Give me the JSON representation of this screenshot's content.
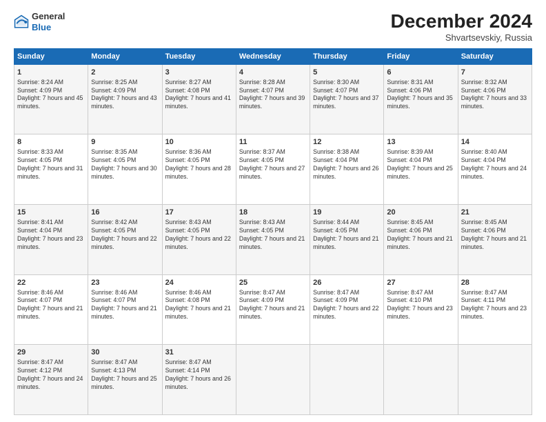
{
  "logo": {
    "general": "General",
    "blue": "Blue"
  },
  "header": {
    "month": "December 2024",
    "location": "Shvartsevskiy, Russia"
  },
  "weekdays": [
    "Sunday",
    "Monday",
    "Tuesday",
    "Wednesday",
    "Thursday",
    "Friday",
    "Saturday"
  ],
  "weeks": [
    [
      {
        "day": "1",
        "sunrise": "Sunrise: 8:24 AM",
        "sunset": "Sunset: 4:09 PM",
        "daylight": "Daylight: 7 hours and 45 minutes."
      },
      {
        "day": "2",
        "sunrise": "Sunrise: 8:25 AM",
        "sunset": "Sunset: 4:09 PM",
        "daylight": "Daylight: 7 hours and 43 minutes."
      },
      {
        "day": "3",
        "sunrise": "Sunrise: 8:27 AM",
        "sunset": "Sunset: 4:08 PM",
        "daylight": "Daylight: 7 hours and 41 minutes."
      },
      {
        "day": "4",
        "sunrise": "Sunrise: 8:28 AM",
        "sunset": "Sunset: 4:07 PM",
        "daylight": "Daylight: 7 hours and 39 minutes."
      },
      {
        "day": "5",
        "sunrise": "Sunrise: 8:30 AM",
        "sunset": "Sunset: 4:07 PM",
        "daylight": "Daylight: 7 hours and 37 minutes."
      },
      {
        "day": "6",
        "sunrise": "Sunrise: 8:31 AM",
        "sunset": "Sunset: 4:06 PM",
        "daylight": "Daylight: 7 hours and 35 minutes."
      },
      {
        "day": "7",
        "sunrise": "Sunrise: 8:32 AM",
        "sunset": "Sunset: 4:06 PM",
        "daylight": "Daylight: 7 hours and 33 minutes."
      }
    ],
    [
      {
        "day": "8",
        "sunrise": "Sunrise: 8:33 AM",
        "sunset": "Sunset: 4:05 PM",
        "daylight": "Daylight: 7 hours and 31 minutes."
      },
      {
        "day": "9",
        "sunrise": "Sunrise: 8:35 AM",
        "sunset": "Sunset: 4:05 PM",
        "daylight": "Daylight: 7 hours and 30 minutes."
      },
      {
        "day": "10",
        "sunrise": "Sunrise: 8:36 AM",
        "sunset": "Sunset: 4:05 PM",
        "daylight": "Daylight: 7 hours and 28 minutes."
      },
      {
        "day": "11",
        "sunrise": "Sunrise: 8:37 AM",
        "sunset": "Sunset: 4:05 PM",
        "daylight": "Daylight: 7 hours and 27 minutes."
      },
      {
        "day": "12",
        "sunrise": "Sunrise: 8:38 AM",
        "sunset": "Sunset: 4:04 PM",
        "daylight": "Daylight: 7 hours and 26 minutes."
      },
      {
        "day": "13",
        "sunrise": "Sunrise: 8:39 AM",
        "sunset": "Sunset: 4:04 PM",
        "daylight": "Daylight: 7 hours and 25 minutes."
      },
      {
        "day": "14",
        "sunrise": "Sunrise: 8:40 AM",
        "sunset": "Sunset: 4:04 PM",
        "daylight": "Daylight: 7 hours and 24 minutes."
      }
    ],
    [
      {
        "day": "15",
        "sunrise": "Sunrise: 8:41 AM",
        "sunset": "Sunset: 4:04 PM",
        "daylight": "Daylight: 7 hours and 23 minutes."
      },
      {
        "day": "16",
        "sunrise": "Sunrise: 8:42 AM",
        "sunset": "Sunset: 4:05 PM",
        "daylight": "Daylight: 7 hours and 22 minutes."
      },
      {
        "day": "17",
        "sunrise": "Sunrise: 8:43 AM",
        "sunset": "Sunset: 4:05 PM",
        "daylight": "Daylight: 7 hours and 22 minutes."
      },
      {
        "day": "18",
        "sunrise": "Sunrise: 8:43 AM",
        "sunset": "Sunset: 4:05 PM",
        "daylight": "Daylight: 7 hours and 21 minutes."
      },
      {
        "day": "19",
        "sunrise": "Sunrise: 8:44 AM",
        "sunset": "Sunset: 4:05 PM",
        "daylight": "Daylight: 7 hours and 21 minutes."
      },
      {
        "day": "20",
        "sunrise": "Sunrise: 8:45 AM",
        "sunset": "Sunset: 4:06 PM",
        "daylight": "Daylight: 7 hours and 21 minutes."
      },
      {
        "day": "21",
        "sunrise": "Sunrise: 8:45 AM",
        "sunset": "Sunset: 4:06 PM",
        "daylight": "Daylight: 7 hours and 21 minutes."
      }
    ],
    [
      {
        "day": "22",
        "sunrise": "Sunrise: 8:46 AM",
        "sunset": "Sunset: 4:07 PM",
        "daylight": "Daylight: 7 hours and 21 minutes."
      },
      {
        "day": "23",
        "sunrise": "Sunrise: 8:46 AM",
        "sunset": "Sunset: 4:07 PM",
        "daylight": "Daylight: 7 hours and 21 minutes."
      },
      {
        "day": "24",
        "sunrise": "Sunrise: 8:46 AM",
        "sunset": "Sunset: 4:08 PM",
        "daylight": "Daylight: 7 hours and 21 minutes."
      },
      {
        "day": "25",
        "sunrise": "Sunrise: 8:47 AM",
        "sunset": "Sunset: 4:09 PM",
        "daylight": "Daylight: 7 hours and 21 minutes."
      },
      {
        "day": "26",
        "sunrise": "Sunrise: 8:47 AM",
        "sunset": "Sunset: 4:09 PM",
        "daylight": "Daylight: 7 hours and 22 minutes."
      },
      {
        "day": "27",
        "sunrise": "Sunrise: 8:47 AM",
        "sunset": "Sunset: 4:10 PM",
        "daylight": "Daylight: 7 hours and 23 minutes."
      },
      {
        "day": "28",
        "sunrise": "Sunrise: 8:47 AM",
        "sunset": "Sunset: 4:11 PM",
        "daylight": "Daylight: 7 hours and 23 minutes."
      }
    ],
    [
      {
        "day": "29",
        "sunrise": "Sunrise: 8:47 AM",
        "sunset": "Sunset: 4:12 PM",
        "daylight": "Daylight: 7 hours and 24 minutes."
      },
      {
        "day": "30",
        "sunrise": "Sunrise: 8:47 AM",
        "sunset": "Sunset: 4:13 PM",
        "daylight": "Daylight: 7 hours and 25 minutes."
      },
      {
        "day": "31",
        "sunrise": "Sunrise: 8:47 AM",
        "sunset": "Sunset: 4:14 PM",
        "daylight": "Daylight: 7 hours and 26 minutes."
      },
      null,
      null,
      null,
      null
    ]
  ]
}
